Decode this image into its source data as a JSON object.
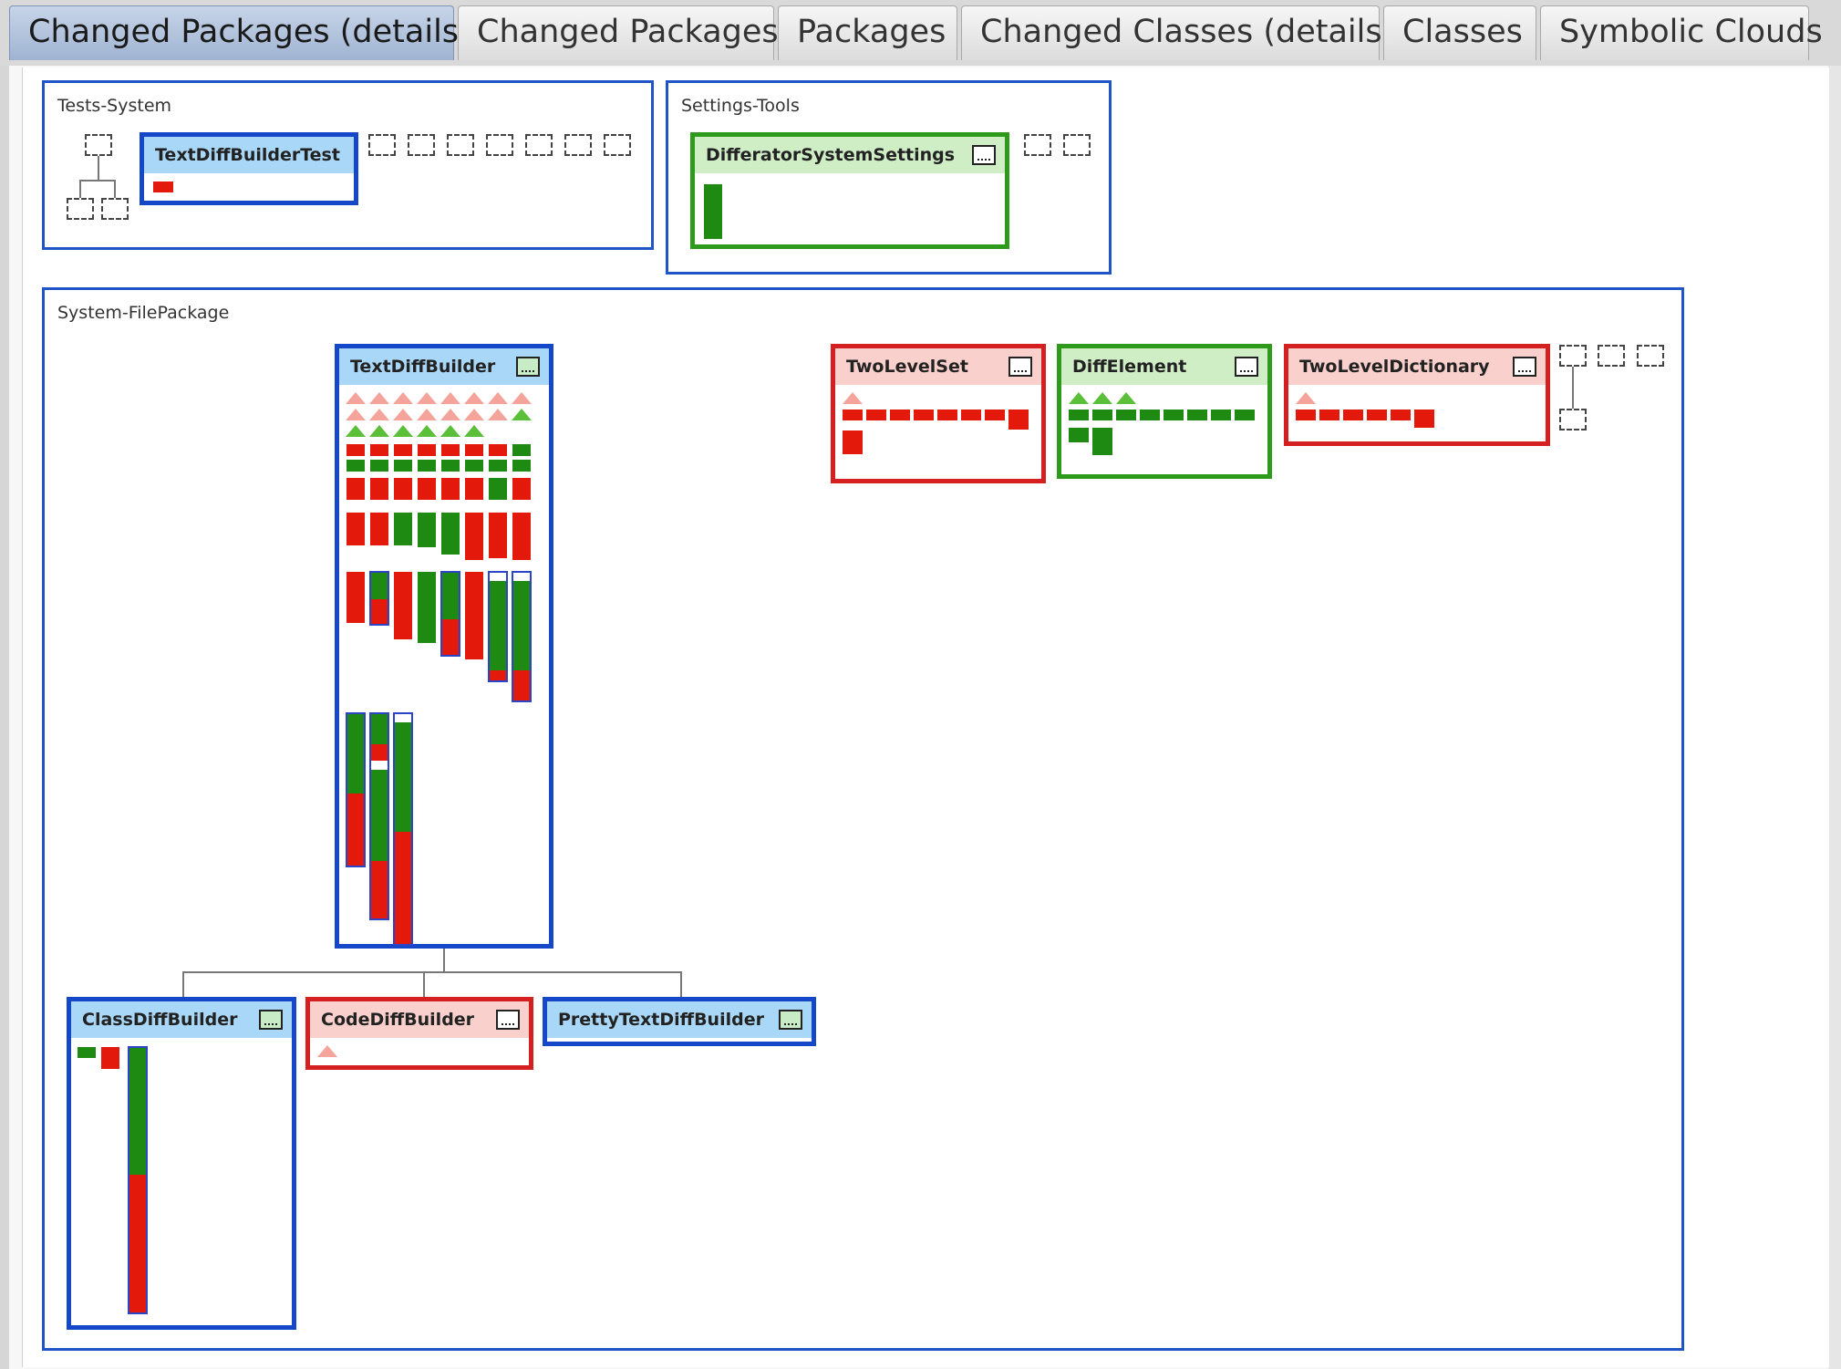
{
  "tabs": [
    {
      "label": "Changed Packages (details)",
      "active": true
    },
    {
      "label": "Changed Packages",
      "active": false
    },
    {
      "label": "Packages",
      "active": false
    },
    {
      "label": "Changed Classes (details)",
      "active": false
    },
    {
      "label": "Classes",
      "active": false
    },
    {
      "label": "Symbolic Clouds",
      "active": false
    }
  ],
  "colors": {
    "added": "#1f8a12",
    "removed": "#e3190b",
    "removed_light": "#f4a49a",
    "added_light": "#5bbf3a",
    "package_border": "#1f55c7",
    "class_blue": "#1547c9",
    "class_red": "#d42020",
    "class_green": "#2e9a1c"
  },
  "packages": {
    "tests_system": {
      "name": "Tests-System",
      "classes": {
        "text_diff_builder_test": {
          "name": "TextDiffBuilderTest",
          "status": "changed"
        }
      }
    },
    "settings_tools": {
      "name": "Settings-Tools",
      "classes": {
        "differator_system_settings": {
          "name": "DifferatorSystemSettings",
          "status": "added"
        }
      }
    },
    "system_file_package": {
      "name": "System-FilePackage",
      "classes": {
        "text_diff_builder": {
          "name": "TextDiffBuilder",
          "status": "changed"
        },
        "two_level_set": {
          "name": "TwoLevelSet",
          "status": "removed"
        },
        "diff_element": {
          "name": "DiffElement",
          "status": "added"
        },
        "two_level_dictionary": {
          "name": "TwoLevelDictionary",
          "status": "removed"
        },
        "class_diff_builder": {
          "name": "ClassDiffBuilder",
          "status": "changed"
        },
        "code_diff_builder": {
          "name": "CodeDiffBuilder",
          "status": "removed"
        },
        "pretty_text_diff_builder": {
          "name": "PrettyTextDiffBuilder",
          "status": "changed"
        }
      }
    }
  }
}
